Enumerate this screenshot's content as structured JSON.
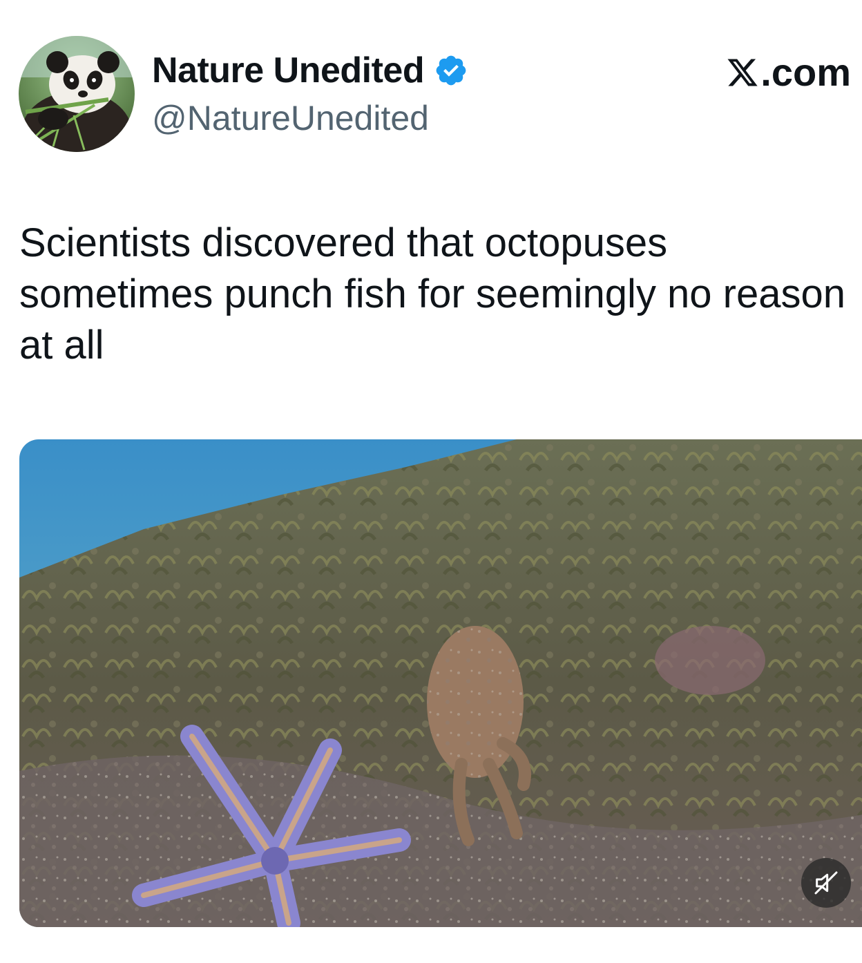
{
  "author": {
    "display_name": "Nature Unedited",
    "handle": "@NatureUnedited",
    "verified": true,
    "avatar_icon": "panda-avatar"
  },
  "brand": {
    "label": ".com",
    "icon": "x-logo-icon"
  },
  "tweet": {
    "text": "Scientists discovered that octopuses sometimes punch fish for seemingly no reason at all"
  },
  "media": {
    "type": "video",
    "muted": true,
    "mute_icon": "muted-speaker-icon"
  },
  "colors": {
    "text": "#0f1419",
    "secondary_text": "#536471",
    "verified_blue": "#1d9bf0"
  }
}
